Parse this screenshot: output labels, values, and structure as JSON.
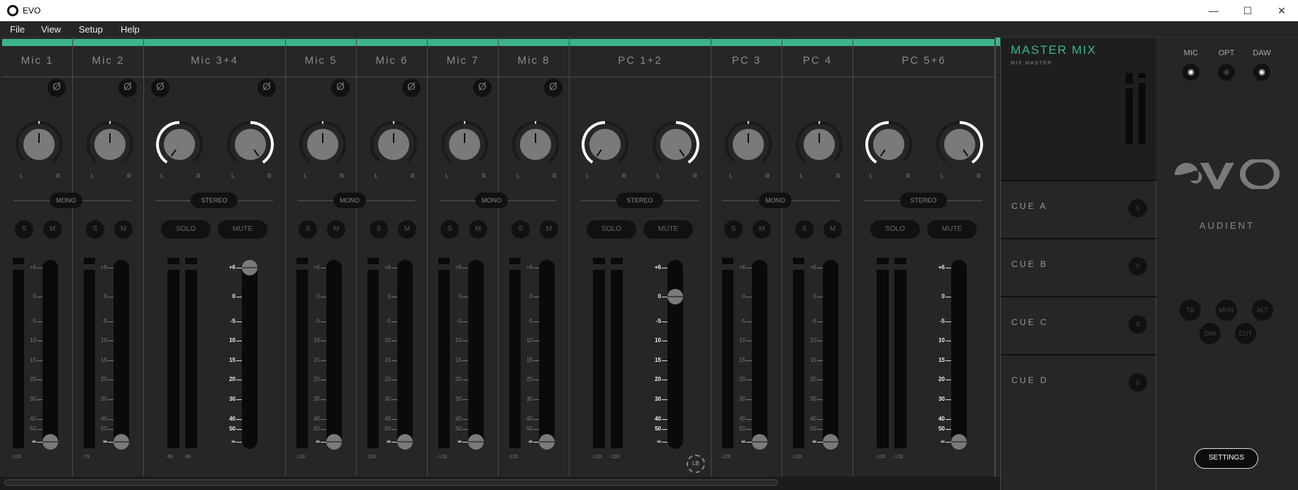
{
  "window": {
    "title": "EVO",
    "minimize": "—",
    "maximize": "☐",
    "close": "✕"
  },
  "menu": [
    "File",
    "View",
    "Setup",
    "Help"
  ],
  "colors": {
    "accent": "#3cb48a",
    "bg": "#262626"
  },
  "strips": [
    {
      "name": "Mic 1",
      "type": "mono",
      "phase": true,
      "pan": [
        0
      ],
      "fader_db": "inf",
      "meters": [
        "-128"
      ],
      "mode": "MONO",
      "solo": "S",
      "mute": "M"
    },
    {
      "name": "Mic 2",
      "type": "mono",
      "phase": true,
      "pan": [
        0
      ],
      "fader_db": "inf",
      "meters": [
        "-79"
      ],
      "solo": "S",
      "mute": "M"
    },
    {
      "name": "Mic 3+4",
      "type": "stereo",
      "phase": true,
      "pan": [
        -1,
        1
      ],
      "fader_db": "+6",
      "meters": [
        "-96",
        "-96"
      ],
      "mode": "STEREO",
      "solo": "SOLO",
      "mute": "MUTE"
    },
    {
      "name": "Mic 5",
      "type": "mono",
      "phase": true,
      "pan": [
        0
      ],
      "fader_db": "inf",
      "meters": [
        "-128"
      ],
      "mode": "MONO",
      "solo": "S",
      "mute": "M"
    },
    {
      "name": "Mic 6",
      "type": "mono",
      "phase": true,
      "pan": [
        0
      ],
      "fader_db": "inf",
      "meters": [
        "-128"
      ],
      "solo": "S",
      "mute": "M"
    },
    {
      "name": "Mic 7",
      "type": "mono",
      "phase": true,
      "pan": [
        0
      ],
      "fader_db": "inf",
      "meters": [
        "-128"
      ],
      "mode": "MONO",
      "solo": "S",
      "mute": "M"
    },
    {
      "name": "Mic 8",
      "type": "mono",
      "phase": true,
      "pan": [
        0
      ],
      "fader_db": "inf",
      "meters": [
        "-128"
      ],
      "solo": "S",
      "mute": "M"
    },
    {
      "name": "PC 1+2",
      "type": "stereo",
      "phase": false,
      "pan": [
        -1,
        1
      ],
      "fader_db": "0",
      "meters": [
        "-128",
        "-128"
      ],
      "mode": "STEREO",
      "solo": "SOLO",
      "mute": "MUTE",
      "loopback": "LB"
    },
    {
      "name": "PC 3",
      "type": "mono",
      "phase": false,
      "pan": [
        0
      ],
      "fader_db": "inf",
      "meters": [
        "-128"
      ],
      "mode": "MONO",
      "solo": "S",
      "mute": "M"
    },
    {
      "name": "PC 4",
      "type": "mono",
      "phase": false,
      "pan": [
        0
      ],
      "fader_db": "inf",
      "meters": [
        "-128"
      ],
      "solo": "S",
      "mute": "M"
    },
    {
      "name": "PC 5+6",
      "type": "stereo",
      "phase": false,
      "pan": [
        -1,
        1
      ],
      "fader_db": "inf",
      "meters": [
        "-128",
        "-128"
      ],
      "mode": "STEREO",
      "solo": "SOLO",
      "mute": "MUTE"
    }
  ],
  "scale": [
    "+6",
    "0",
    "-5",
    "10",
    "15",
    "20",
    "30",
    "40",
    "50",
    "∞"
  ],
  "pan_labels": {
    "left": "L",
    "right": "R"
  },
  "master": {
    "title": "MASTER MIX",
    "subtitle": "MIX MASTER",
    "cues": [
      {
        "label": "CUE A",
        "solo": "S"
      },
      {
        "label": "CUE B",
        "solo": "S"
      },
      {
        "label": "CUE C",
        "solo": "S"
      },
      {
        "label": "CUE D",
        "solo": "S"
      }
    ]
  },
  "right": {
    "sources": [
      {
        "label": "MIC",
        "active": true
      },
      {
        "label": "OPT",
        "active": false
      },
      {
        "label": "DAW",
        "active": true
      }
    ],
    "logo": "evo",
    "brand": "AUDIENT",
    "monitor_buttons": [
      "TB",
      "MON",
      "ALT",
      "DIM",
      "CUT"
    ],
    "settings": "SETTINGS"
  }
}
